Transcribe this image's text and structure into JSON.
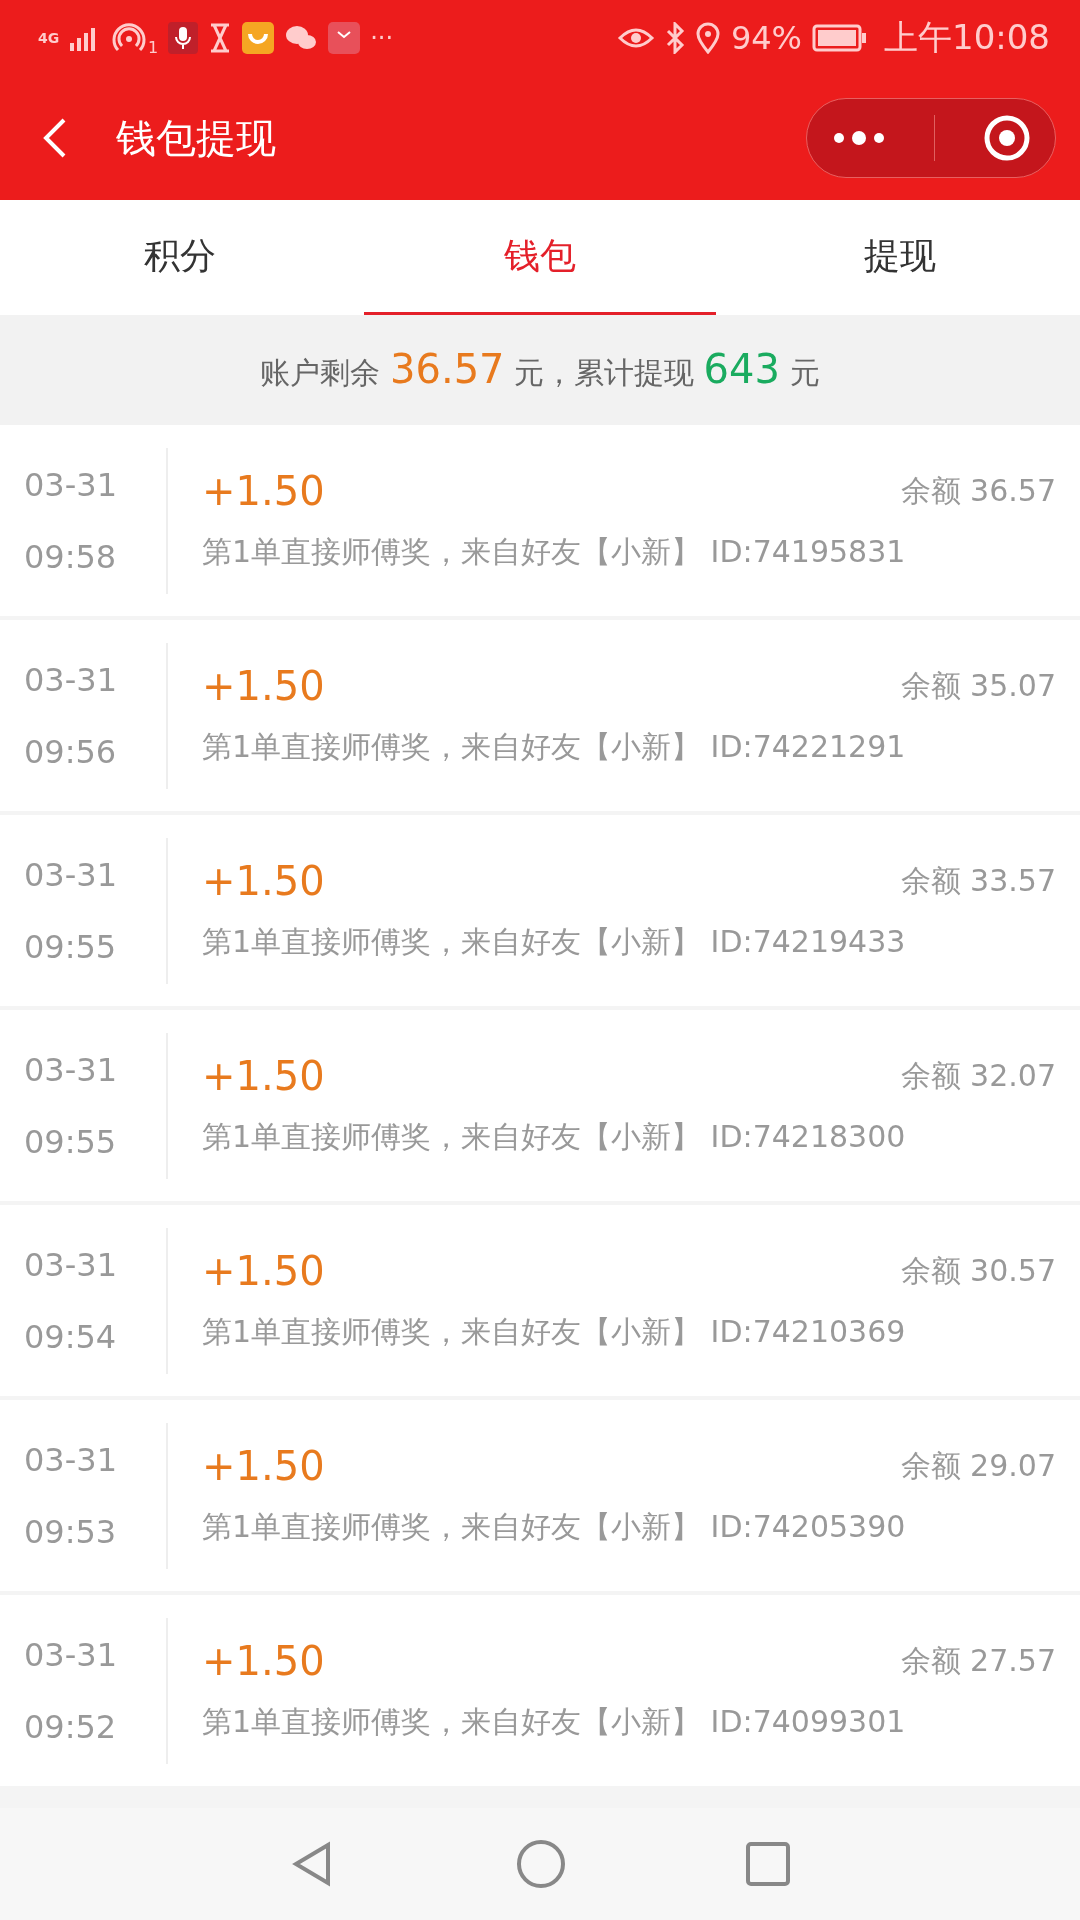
{
  "status_bar": {
    "network": "4G",
    "hotspot_count": "1",
    "more": "···",
    "battery": "94%",
    "time": "上午10:08"
  },
  "header": {
    "title": "钱包提现"
  },
  "tabs": [
    {
      "label": "积分",
      "selected": false
    },
    {
      "label": "钱包",
      "selected": true
    },
    {
      "label": "提现",
      "selected": false
    }
  ],
  "summary": {
    "balance_label": "账户剩余",
    "balance": "36.57",
    "balance_unit": "元，",
    "total_label": "累计提现",
    "total": "643",
    "total_unit": "元"
  },
  "records": [
    {
      "date": "03-31",
      "time": "09:58",
      "amount": "+1.50",
      "balance": "余额 36.57",
      "description": "第1单直接师傅奖，来自好友【小新】 ID:74195831"
    },
    {
      "date": "03-31",
      "time": "09:56",
      "amount": "+1.50",
      "balance": "余额 35.07",
      "description": "第1单直接师傅奖，来自好友【小新】 ID:74221291"
    },
    {
      "date": "03-31",
      "time": "09:55",
      "amount": "+1.50",
      "balance": "余额 33.57",
      "description": "第1单直接师傅奖，来自好友【小新】 ID:74219433"
    },
    {
      "date": "03-31",
      "time": "09:55",
      "amount": "+1.50",
      "balance": "余额 32.07",
      "description": "第1单直接师傅奖，来自好友【小新】 ID:74218300"
    },
    {
      "date": "03-31",
      "time": "09:54",
      "amount": "+1.50",
      "balance": "余额 30.57",
      "description": "第1单直接师傅奖，来自好友【小新】 ID:74210369"
    },
    {
      "date": "03-31",
      "time": "09:53",
      "amount": "+1.50",
      "balance": "余额 29.07",
      "description": "第1单直接师傅奖，来自好友【小新】 ID:74205390"
    },
    {
      "date": "03-31",
      "time": "09:52",
      "amount": "+1.50",
      "balance": "余额 27.57",
      "description": "第1单直接师傅奖，来自好友【小新】 ID:74099301"
    }
  ]
}
